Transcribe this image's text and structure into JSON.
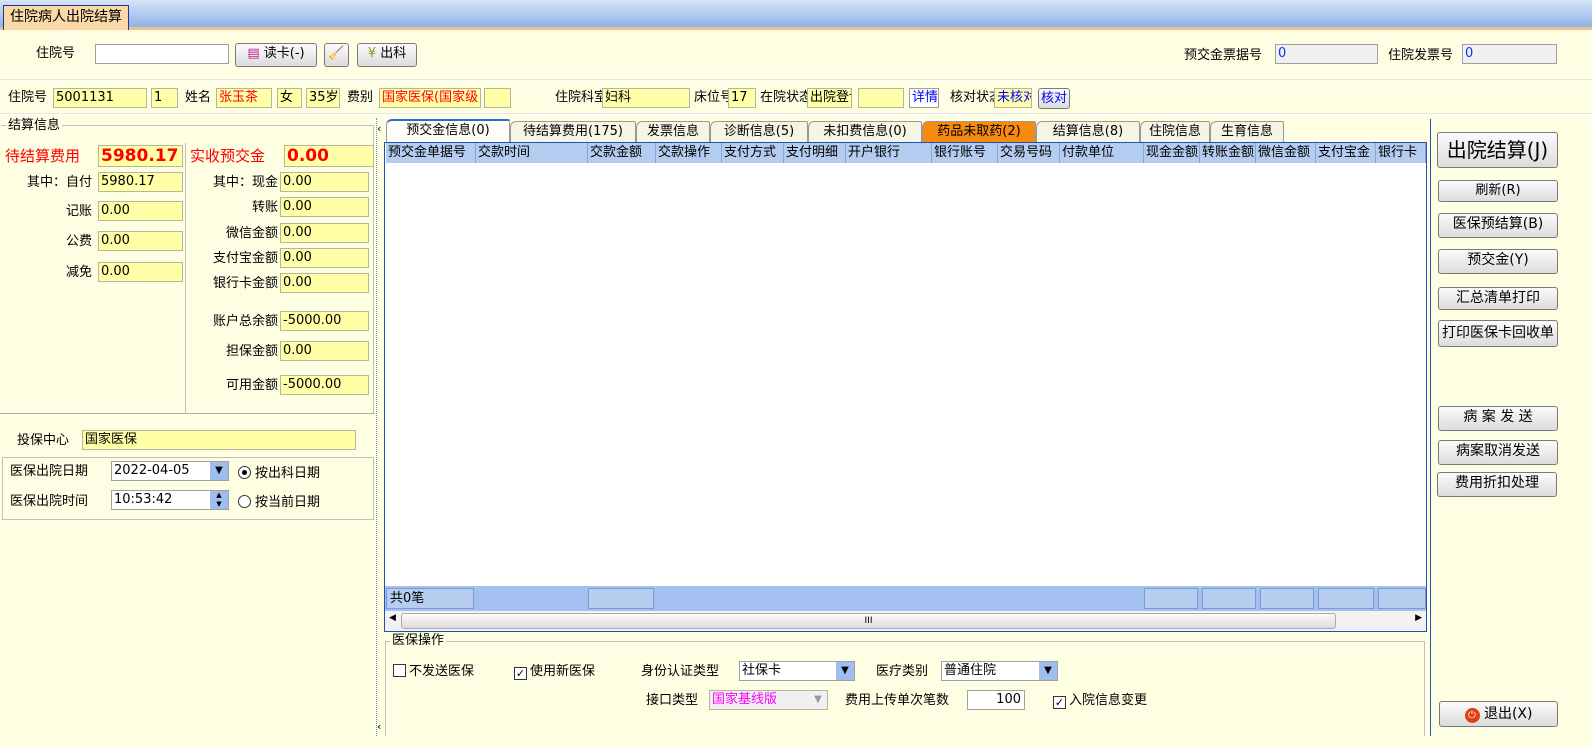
{
  "window_tab": "住院病人出院结算",
  "search": {
    "label": "住院号",
    "value": "",
    "read_card": "读卡(-)",
    "clear_icon": "broom-icon",
    "discharge": "出科",
    "prepay_receipt_label": "预交金票据号",
    "prepay_receipt_value": "0",
    "invoice_label": "住院发票号",
    "invoice_value": "0"
  },
  "patient": {
    "id_label": "住院号",
    "id": "5001131",
    "times": "1",
    "name_label": "姓名",
    "name": "张玉茶",
    "sex": "女",
    "age": "35岁",
    "fee_type_label": "费别",
    "fee_type": "国家医保(国家级",
    "fee_extra": "",
    "dept_label": "住院科室",
    "dept": "妇科",
    "bed_label": "床位号",
    "bed": "17",
    "status_label": "在院状态",
    "status": "出院登记",
    "status_extra": "",
    "detail": "详情",
    "check_label": "核对状态",
    "check_status": "未核对",
    "check_btn": "核对"
  },
  "settle": {
    "group": "结算信息",
    "pending_label": "待结算费用",
    "pending": "5980.17",
    "received_label": "实收预交金",
    "received": "0.00",
    "left": [
      {
        "label": "其中：自付",
        "value": "5980.17"
      },
      {
        "label": "记账",
        "value": "0.00"
      },
      {
        "label": "公费",
        "value": "0.00"
      },
      {
        "label": "减免",
        "value": "0.00"
      }
    ],
    "right": [
      {
        "label": "其中：现金",
        "value": "0.00"
      },
      {
        "label": "转账",
        "value": "0.00"
      },
      {
        "label": "微信金额",
        "value": "0.00"
      },
      {
        "label": "支付宝金额",
        "value": "0.00"
      },
      {
        "label": "银行卡金额",
        "value": "0.00"
      },
      {
        "label": "账户总余额",
        "value": "-5000.00"
      },
      {
        "label": "担保金额",
        "value": "0.00"
      },
      {
        "label": "可用金额",
        "value": "-5000.00"
      }
    ]
  },
  "insurance": {
    "center_label": "投保中心",
    "center": "国家医保",
    "date_label": "医保出院日期",
    "date": "2022-04-05",
    "time_label": "医保出院时间",
    "time": "10:53:42",
    "radio1": "按出科日期",
    "radio2": "按当前日期",
    "radio_selected": "按出科日期"
  },
  "tabs": [
    {
      "label": "预交金信息(0)"
    },
    {
      "label": "待结算费用(175)"
    },
    {
      "label": "发票信息"
    },
    {
      "label": "诊断信息(5)"
    },
    {
      "label": "未扣费信息(0)"
    },
    {
      "label": "药品未取药(2)"
    },
    {
      "label": "结算信息(8)"
    },
    {
      "label": "住院信息"
    },
    {
      "label": "生育信息"
    }
  ],
  "active_tab": "预交金信息(0)",
  "highlight_color": "#f78a10",
  "grid": {
    "columns": [
      "预交金单据号",
      "交款时间",
      "交款金额",
      "交款操作",
      "支付方式",
      "支付明细",
      "开户银行",
      "银行账号",
      "交易号码",
      "付款单位",
      "现金金额",
      "转账金额",
      "微信金额",
      "支付宝金",
      "银行卡"
    ],
    "rows": [],
    "footer": "共0笔"
  },
  "ops": {
    "group": "医保操作",
    "no_send": "不发送医保",
    "no_send_checked": false,
    "use_new": "使用新医保",
    "use_new_checked": true,
    "id_type_label": "身份认证类型",
    "id_type": "社保卡",
    "med_type_label": "医疗类别",
    "med_type": "普通住院",
    "iface_label": "接口类型",
    "iface": "国家基线版",
    "upload_label": "费用上传单次笔数",
    "upload": "100",
    "admit_change": "入院信息变更",
    "admit_change_checked": true
  },
  "actions": {
    "settle": "出院结算(J)",
    "refresh": "刷新(R)",
    "pre_settle": "医保预结算(B)",
    "prepay": "预交金(Y)",
    "print_summary": "汇总清单打印",
    "print_card": "打印医保卡回收单",
    "case_send": "病 案 发 送",
    "case_cancel": "病案取消发送",
    "discount": "费用折扣处理",
    "exit": "退出(X)"
  }
}
